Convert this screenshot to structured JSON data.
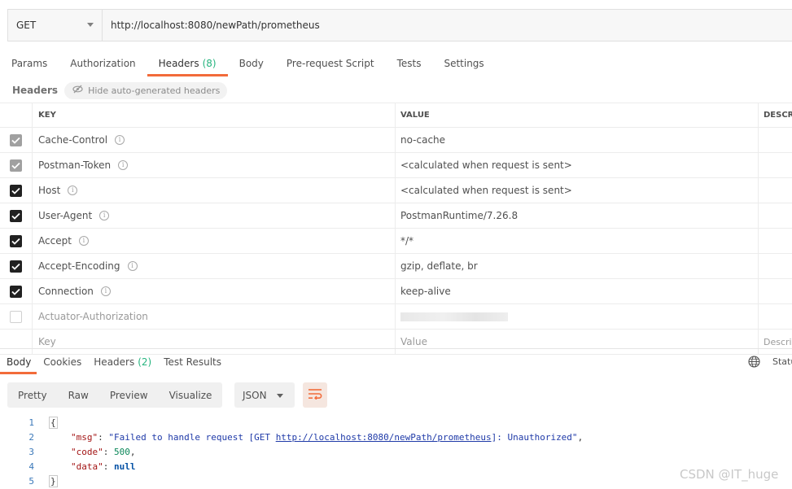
{
  "request": {
    "method": "GET",
    "url": "http://localhost:8080/newPath/prometheus"
  },
  "tabs": [
    {
      "label": "Params",
      "count": ""
    },
    {
      "label": "Authorization",
      "count": ""
    },
    {
      "label": "Headers",
      "count": "(8)",
      "active": true
    },
    {
      "label": "Body",
      "count": ""
    },
    {
      "label": "Pre-request Script",
      "count": ""
    },
    {
      "label": "Tests",
      "count": ""
    },
    {
      "label": "Settings",
      "count": ""
    }
  ],
  "headers_section": {
    "label": "Headers",
    "hide_button": "Hide auto-generated headers"
  },
  "table": {
    "columns": {
      "key": "KEY",
      "value": "VALUE",
      "description": "DESCRI"
    },
    "rows": [
      {
        "key": "Cache-Control",
        "value": "no-cache",
        "checked": "grey"
      },
      {
        "key": "Postman-Token",
        "value": "<calculated when request is sent>",
        "checked": "grey"
      },
      {
        "key": "Host",
        "value": "<calculated when request is sent>",
        "checked": "on"
      },
      {
        "key": "User-Agent",
        "value": "PostmanRuntime/7.26.8",
        "checked": "on"
      },
      {
        "key": "Accept",
        "value": "*/*",
        "checked": "on"
      },
      {
        "key": "Accept-Encoding",
        "value": "gzip, deflate, br",
        "checked": "on"
      },
      {
        "key": "Connection",
        "value": "keep-alive",
        "checked": "on"
      },
      {
        "key": "Actuator-Authorization",
        "value": "",
        "checked": "off"
      }
    ],
    "placeholders": {
      "key": "Key",
      "value": "Value",
      "description": "Descri"
    }
  },
  "response": {
    "tabs": [
      {
        "label": "Body",
        "count": "",
        "active": true
      },
      {
        "label": "Cookies",
        "count": ""
      },
      {
        "label": "Headers",
        "count": "(2)"
      },
      {
        "label": "Test Results",
        "count": ""
      }
    ],
    "status_label": "Statu",
    "views": [
      "Pretty",
      "Raw",
      "Preview",
      "Visualize"
    ],
    "format": "JSON",
    "code": {
      "line_numbers": [
        "1",
        "2",
        "3",
        "4",
        "5"
      ],
      "open_brace": "{",
      "close_brace": "}",
      "msg_key": "\"msg\"",
      "msg_prefix": "\"Failed to handle request [GET ",
      "msg_link": "http://localhost:8080/newPath/prometheus",
      "msg_suffix": "]: Unauthorized\"",
      "code_key": "\"code\"",
      "code_value": "500",
      "data_key": "\"data\"",
      "data_value": "null"
    }
  },
  "watermark": "CSDN @IT_huge"
}
